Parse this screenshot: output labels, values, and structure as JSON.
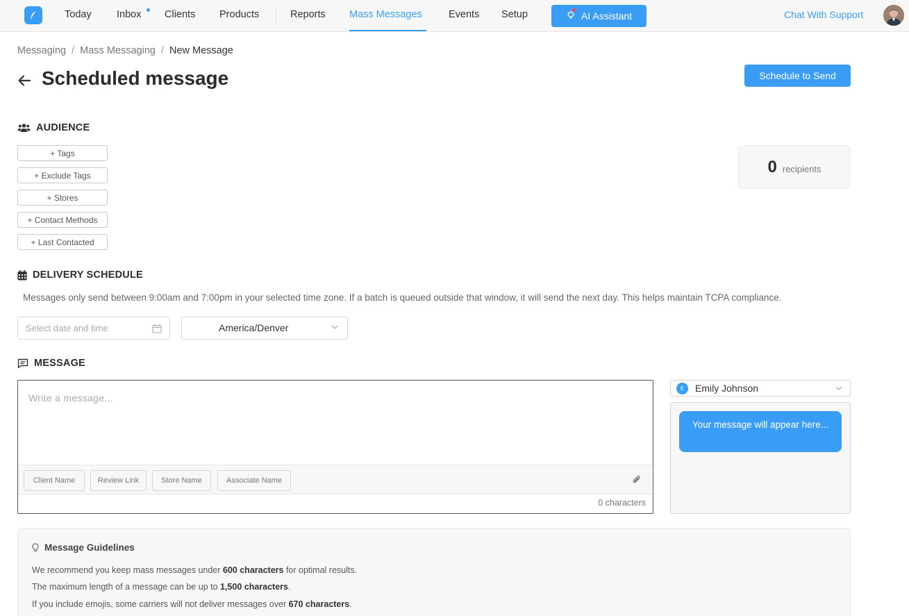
{
  "nav": {
    "items": [
      "Today",
      "Inbox",
      "Clients",
      "Products",
      "Reports",
      "Mass Messages",
      "Events",
      "Setup"
    ],
    "active": "Mass Messages",
    "ai_assistant": "AI Assistant",
    "support": "Chat With Support",
    "accent_color": "#3a9df5"
  },
  "breadcrumb": [
    "Messaging",
    "Mass Messaging",
    "New Message"
  ],
  "header": {
    "title": "Scheduled message",
    "schedule_button": "Schedule to Send"
  },
  "audience": {
    "heading": "AUDIENCE",
    "buttons": [
      "+ Tags",
      "+ Exclude Tags",
      "+ Stores",
      "+ Contact Methods",
      "+ Last Contacted"
    ],
    "recipients_count": "0",
    "recipients_label": "recipients"
  },
  "delivery": {
    "heading": "DELIVERY SCHEDULE",
    "notice": "Messages only send between 9:00am and 7:00pm in your selected time zone. If a batch is queued outside that window, it will send the next day. This helps maintain TCPA compliance.",
    "date_placeholder": "Select date and time",
    "timezone": "America/Denver"
  },
  "message": {
    "heading": "MESSAGE",
    "placeholder": "Write a message...",
    "chips": [
      "Client Name",
      "Review Link",
      "Store Name",
      "Associate Name"
    ],
    "char_count": "0 characters",
    "sender_initial": "E",
    "sender_name": "Emily Johnson",
    "preview_text": "Your message will appear here..."
  },
  "guidelines": {
    "title": "Message Guidelines",
    "line1_pre": "We recommend you keep mass messages under ",
    "line1_bold": "600 characters",
    "line1_post": " for optimal results.",
    "line2_pre": "The maximum length of a message can be up to ",
    "line2_bold": "1,500 characters",
    "line2_post": ".",
    "line3_pre": "If you include emojis, some carriers will not deliver messages over ",
    "line3_bold": "670 characters",
    "line3_post": "."
  }
}
